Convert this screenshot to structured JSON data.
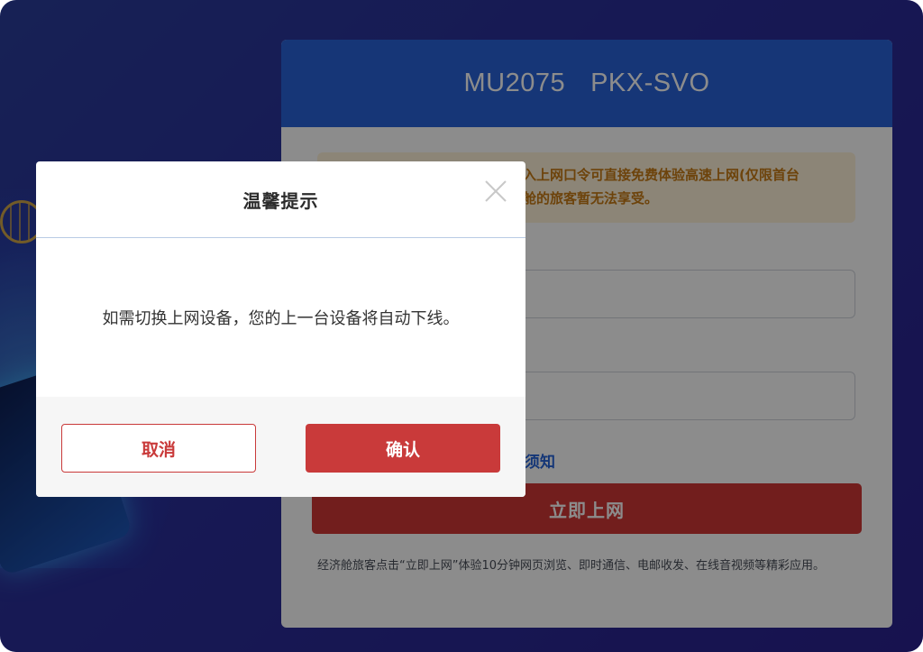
{
  "portal": {
    "flight_number": "MU2075",
    "route": "PKX-SVO",
    "notice_text": "入上网口令可直接免费体验高速上网(仅限首台\n舱的旅客暂无法享受。",
    "terms_link_partial": "须知",
    "connect_button_label": "立即上网",
    "footnote": "经济舱旅客点击“立即上网”体验10分钟网页浏览、即时通信、电邮收发、在线音视频等精彩应用。"
  },
  "dialog": {
    "title": "温馨提示",
    "message": "如需切换上网设备，您的上一台设备将自动下线。",
    "cancel_label": "取消",
    "confirm_label": "确认",
    "close_icon": "close-icon"
  },
  "colors": {
    "header_blue": "#2863d9",
    "accent_red": "#c93a3a",
    "notice_text": "#c77a14",
    "notice_bg": "#fff3d9"
  }
}
